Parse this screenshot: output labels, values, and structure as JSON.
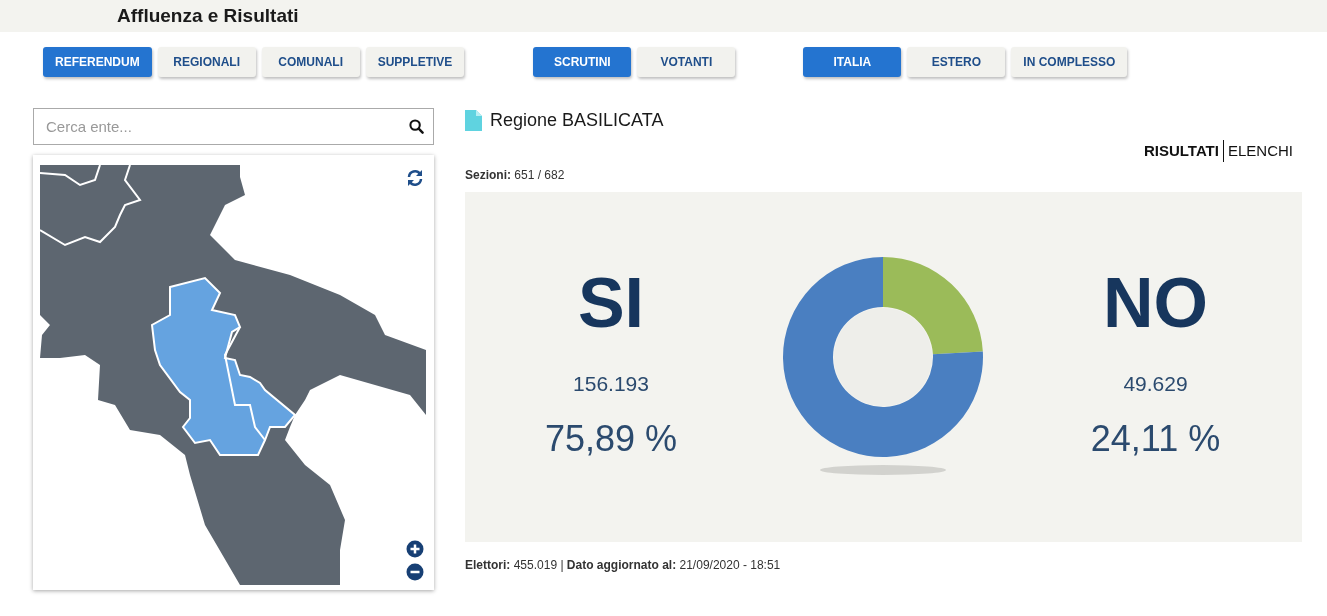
{
  "header": {
    "title": "Affluenza e Risultati"
  },
  "button_groups": [
    [
      {
        "label": "REFERENDUM",
        "selected": true
      },
      {
        "label": "REGIONALI",
        "selected": false
      },
      {
        "label": "COMUNALI",
        "selected": false
      },
      {
        "label": "SUPPLETIVE",
        "selected": false
      }
    ],
    [
      {
        "label": "SCRUTINI",
        "selected": true
      },
      {
        "label": "VOTANTI",
        "selected": false
      }
    ],
    [
      {
        "label": "ITALIA",
        "selected": true
      },
      {
        "label": "ESTERO",
        "selected": false
      },
      {
        "label": "IN COMPLESSO",
        "selected": false
      }
    ]
  ],
  "search": {
    "placeholder": "Cerca ente..."
  },
  "region_title": "Regione BASILICATA",
  "view_tabs": [
    {
      "label": "RISULTATI",
      "selected": true
    },
    {
      "label": "ELENCHI",
      "selected": false
    }
  ],
  "sezioni": {
    "label": "Sezioni:",
    "value": "651 / 682"
  },
  "results": [
    {
      "label": "SI",
      "votes": "156.193",
      "percent": "75,89 %",
      "color": "#4a7fc1"
    },
    {
      "label": "NO",
      "votes": "49.629",
      "percent": "24,11 %",
      "color": "#9bbb59"
    }
  ],
  "chart_data": {
    "type": "donut",
    "values": [
      75.89,
      24.11
    ]
  },
  "footer": {
    "elettori_label": "Elettori:",
    "elettori": "455.019",
    "separator": "|",
    "updated_label": "Dato aggiornato al:",
    "updated": "21/09/2020 - 18:51"
  }
}
